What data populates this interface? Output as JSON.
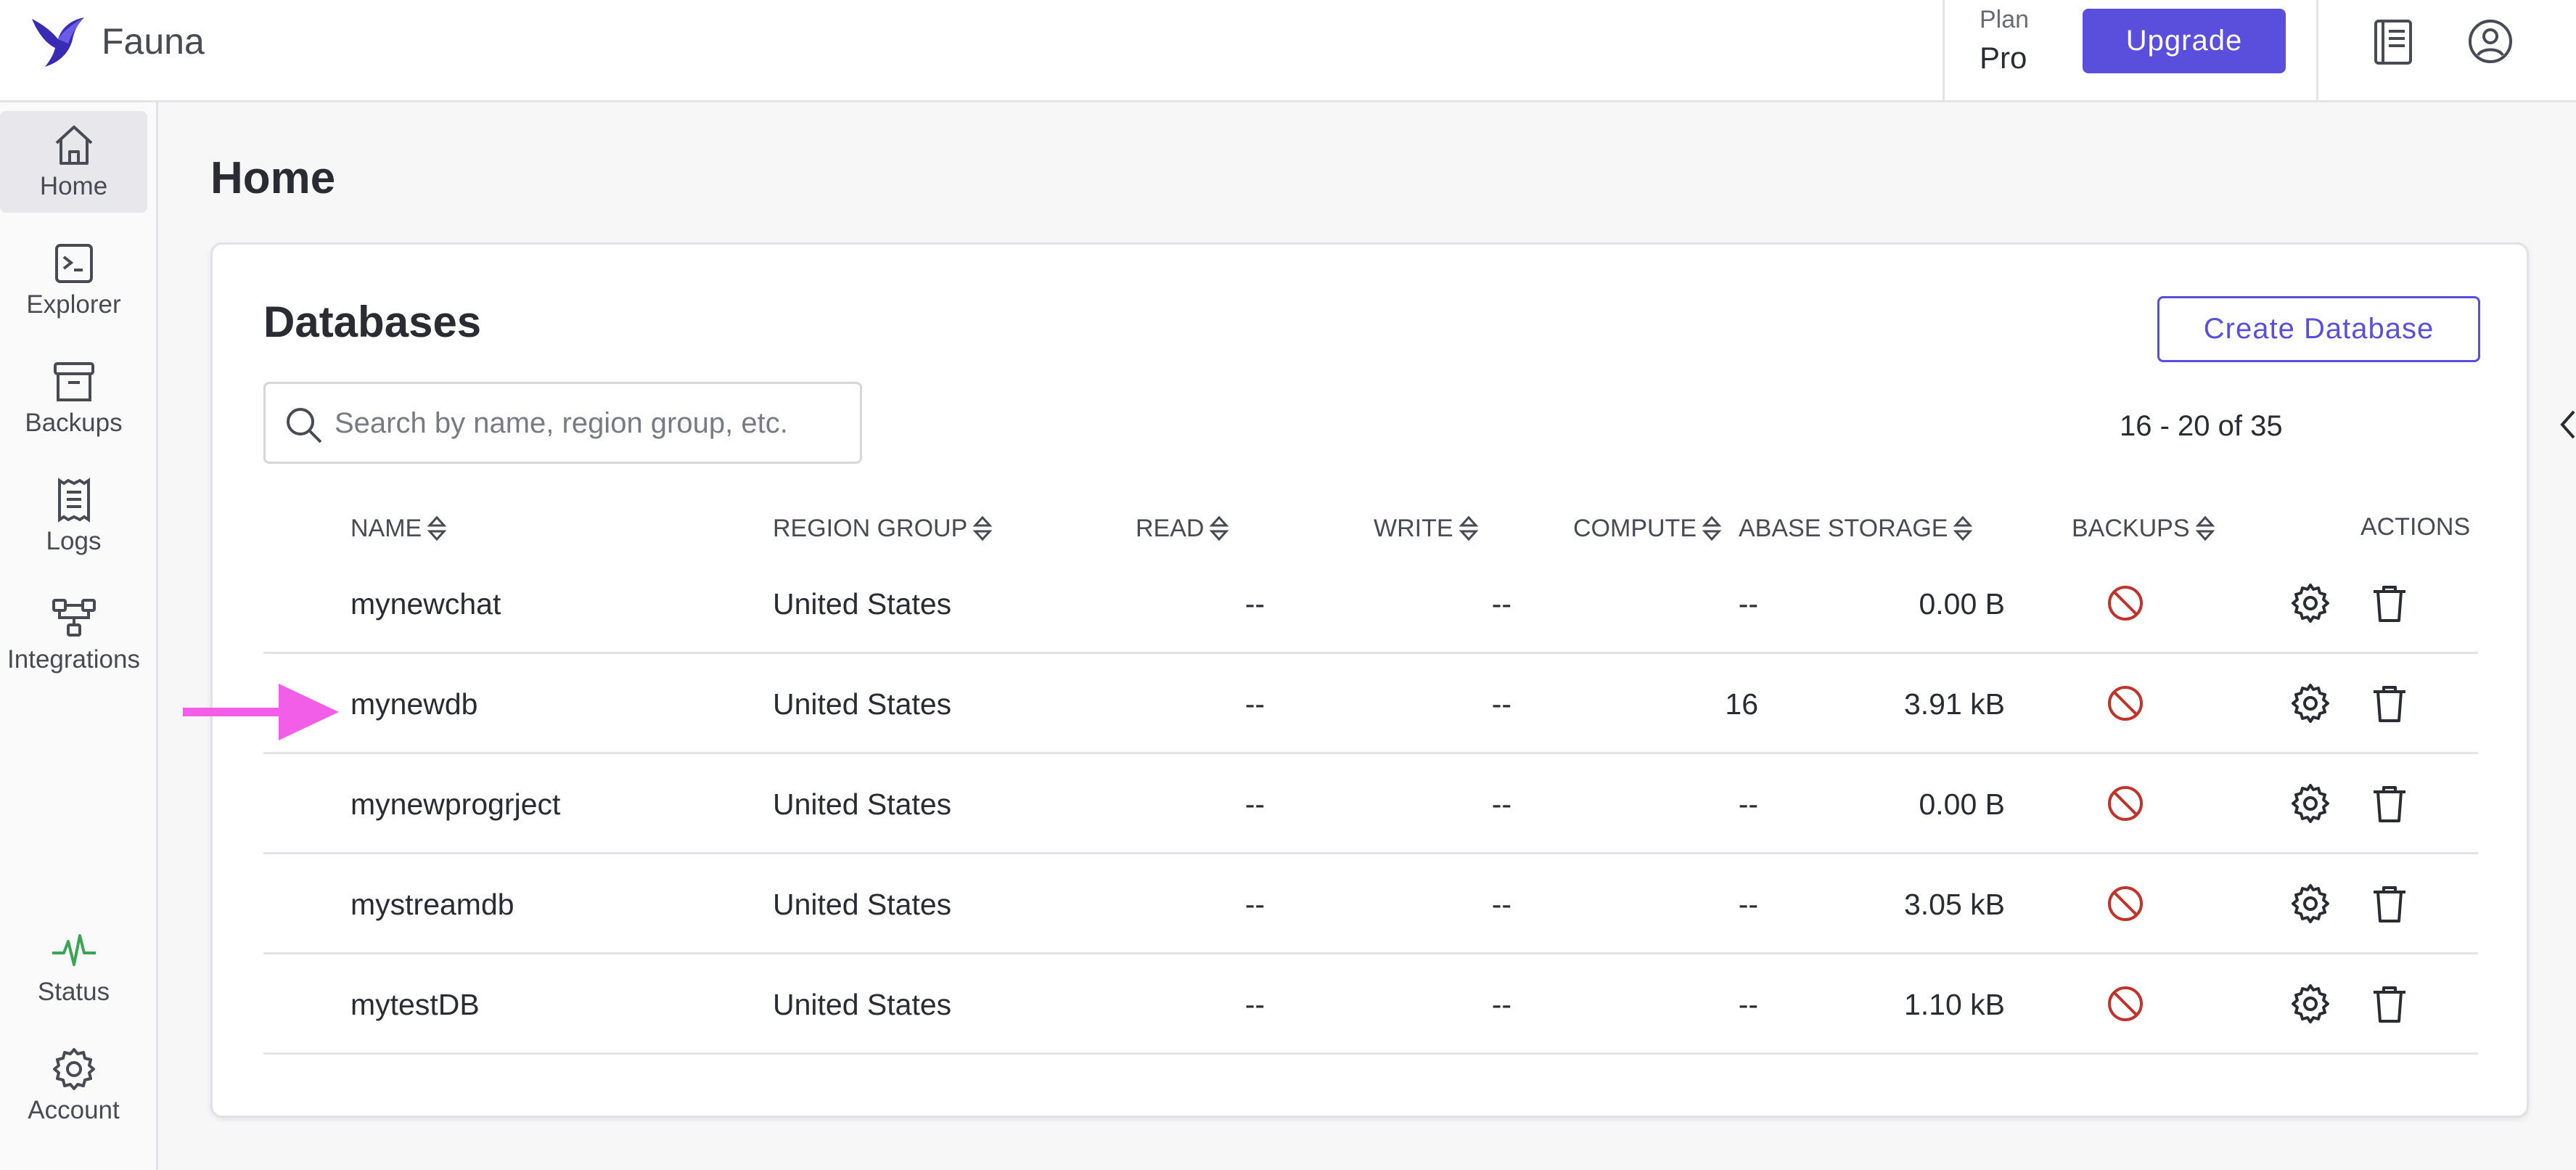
{
  "app": {
    "name": "Fauna"
  },
  "header": {
    "plan_label": "Plan",
    "plan_value": "Pro",
    "upgrade_label": "Upgrade",
    "icons": [
      "docs-icon",
      "user-icon"
    ]
  },
  "sidebar": {
    "items": [
      {
        "label": "Home",
        "icon": "home-icon",
        "active": true
      },
      {
        "label": "Explorer",
        "icon": "terminal-icon"
      },
      {
        "label": "Backups",
        "icon": "archive-icon"
      },
      {
        "label": "Logs",
        "icon": "receipt-icon"
      },
      {
        "label": "Integrations",
        "icon": "integrations-icon"
      }
    ],
    "bottom_items": [
      {
        "label": "Status",
        "icon": "pulse-icon"
      },
      {
        "label": "Account",
        "icon": "gear-icon"
      }
    ]
  },
  "page": {
    "title": "Home"
  },
  "databases": {
    "title": "Databases",
    "create_label": "Create Database",
    "search_placeholder": "Search by name, region group, etc.",
    "pagination": "16 - 20 of 35",
    "columns": {
      "name": "NAME",
      "region": "REGION GROUP",
      "read": "READ",
      "write": "WRITE",
      "compute": "COMPUTE",
      "storage": "ABASE STORAGE",
      "backups": "BACKUPS",
      "actions": "ACTIONS"
    },
    "rows": [
      {
        "name": "mynewchat",
        "region": "United States",
        "read": "--",
        "write": "--",
        "compute": "--",
        "storage": "0.00 B"
      },
      {
        "name": "mynewdb",
        "region": "United States",
        "read": "--",
        "write": "--",
        "compute": "16",
        "storage": "3.91 kB"
      },
      {
        "name": "mynewprogrject",
        "region": "United States",
        "read": "--",
        "write": "--",
        "compute": "--",
        "storage": "0.00 B"
      },
      {
        "name": "mystreamdb",
        "region": "United States",
        "read": "--",
        "write": "--",
        "compute": "--",
        "storage": "3.05 kB"
      },
      {
        "name": "mytestDB",
        "region": "United States",
        "read": "--",
        "write": "--",
        "compute": "--",
        "storage": "1.10 kB"
      }
    ]
  },
  "colors": {
    "accent": "#5a4fdc",
    "backup_disabled": "#c0332b",
    "status_green": "#3aa655",
    "annotation_arrow": "#f25ee8"
  }
}
